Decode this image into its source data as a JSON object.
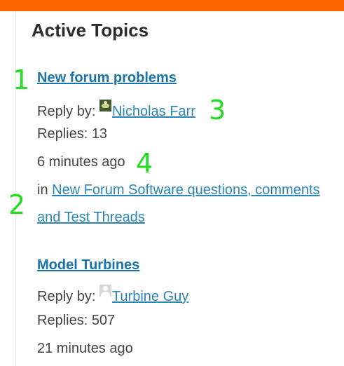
{
  "page": {
    "title": "Active Topics"
  },
  "topics": [
    {
      "title": "New forum problems",
      "reply_by_label": "Reply by:",
      "reply_by_user": "Nicholas Farr",
      "avatar": "user-photo-avatar",
      "replies": "Replies: 13",
      "time": "6 minutes ago",
      "in_label": "in",
      "forum_line1": "New Forum Software questions, comments",
      "forum_line2": "and Test Threads"
    },
    {
      "title": "Model Turbines",
      "reply_by_label": "Reply by:",
      "reply_by_user": "Turbine Guy",
      "avatar": "default-user-avatar",
      "replies": "Replies: 507",
      "time": "21 minutes ago"
    }
  ],
  "annotations": [
    "1",
    "2",
    "3",
    "4"
  ],
  "colors": {
    "top_bar": "#ff6600",
    "link": "#1a73a8",
    "annotation": "#22dd22"
  }
}
